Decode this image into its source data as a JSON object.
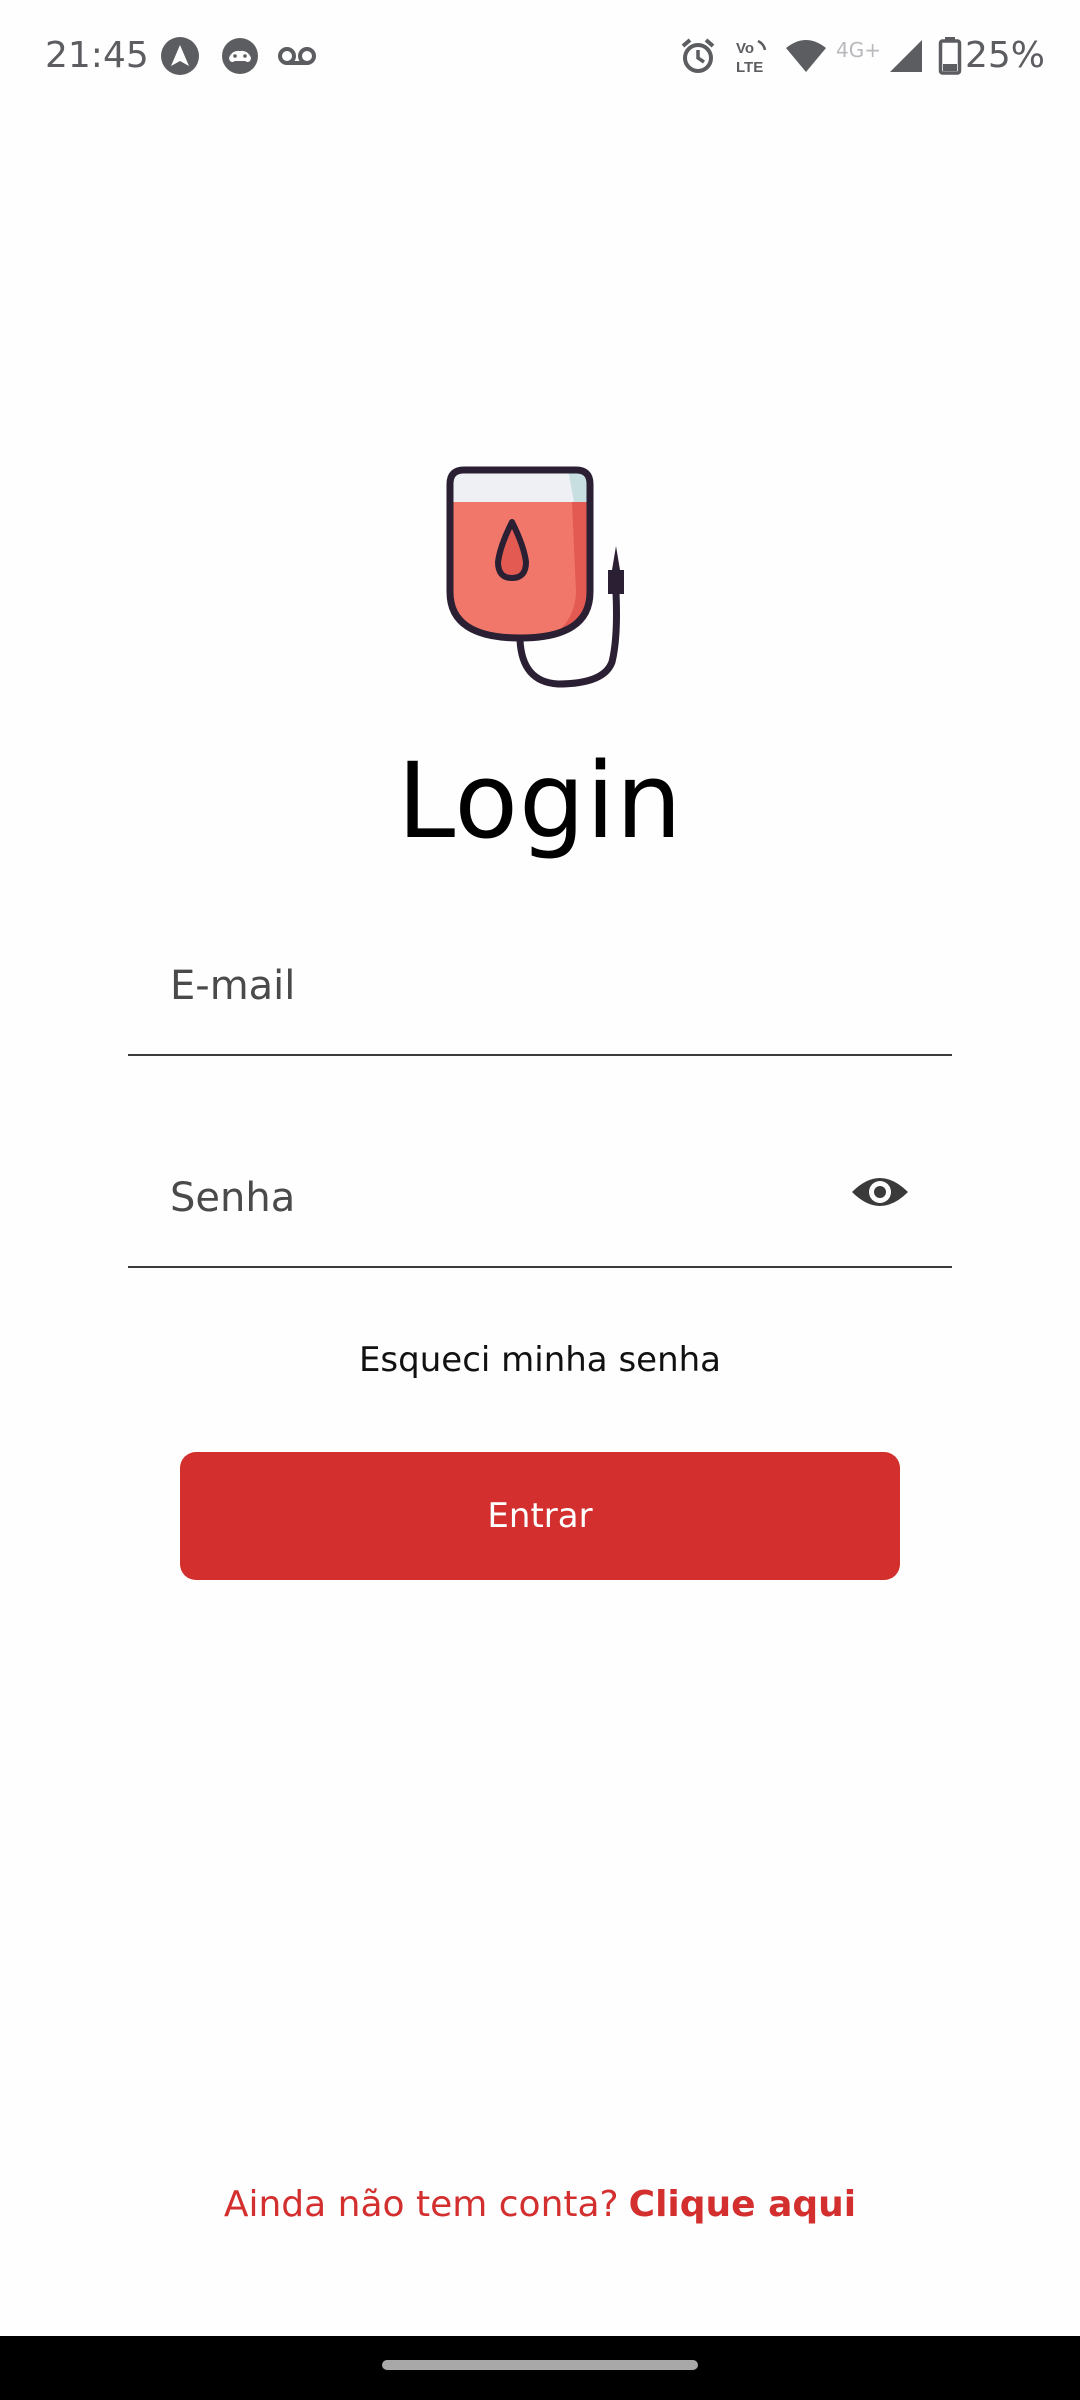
{
  "status_bar": {
    "time": "21:45",
    "battery": "25%",
    "network_label": "4G+",
    "icons": [
      "android-auto-icon",
      "game-icon",
      "voicemail-icon",
      "alarm-icon",
      "volte-icon",
      "wifi-icon",
      "signal-icon",
      "battery-icon"
    ]
  },
  "login": {
    "title": "Login",
    "email_placeholder": "E-mail",
    "password_placeholder": "Senha",
    "forgot_password": "Esqueci minha senha",
    "submit_label": "Entrar",
    "signup_prompt": "Ainda não tem conta?",
    "signup_link": "Clique aqui"
  },
  "colors": {
    "accent": "#d32f2f",
    "logo_fill": "#f1776a",
    "logo_outline": "#2a1f33"
  }
}
